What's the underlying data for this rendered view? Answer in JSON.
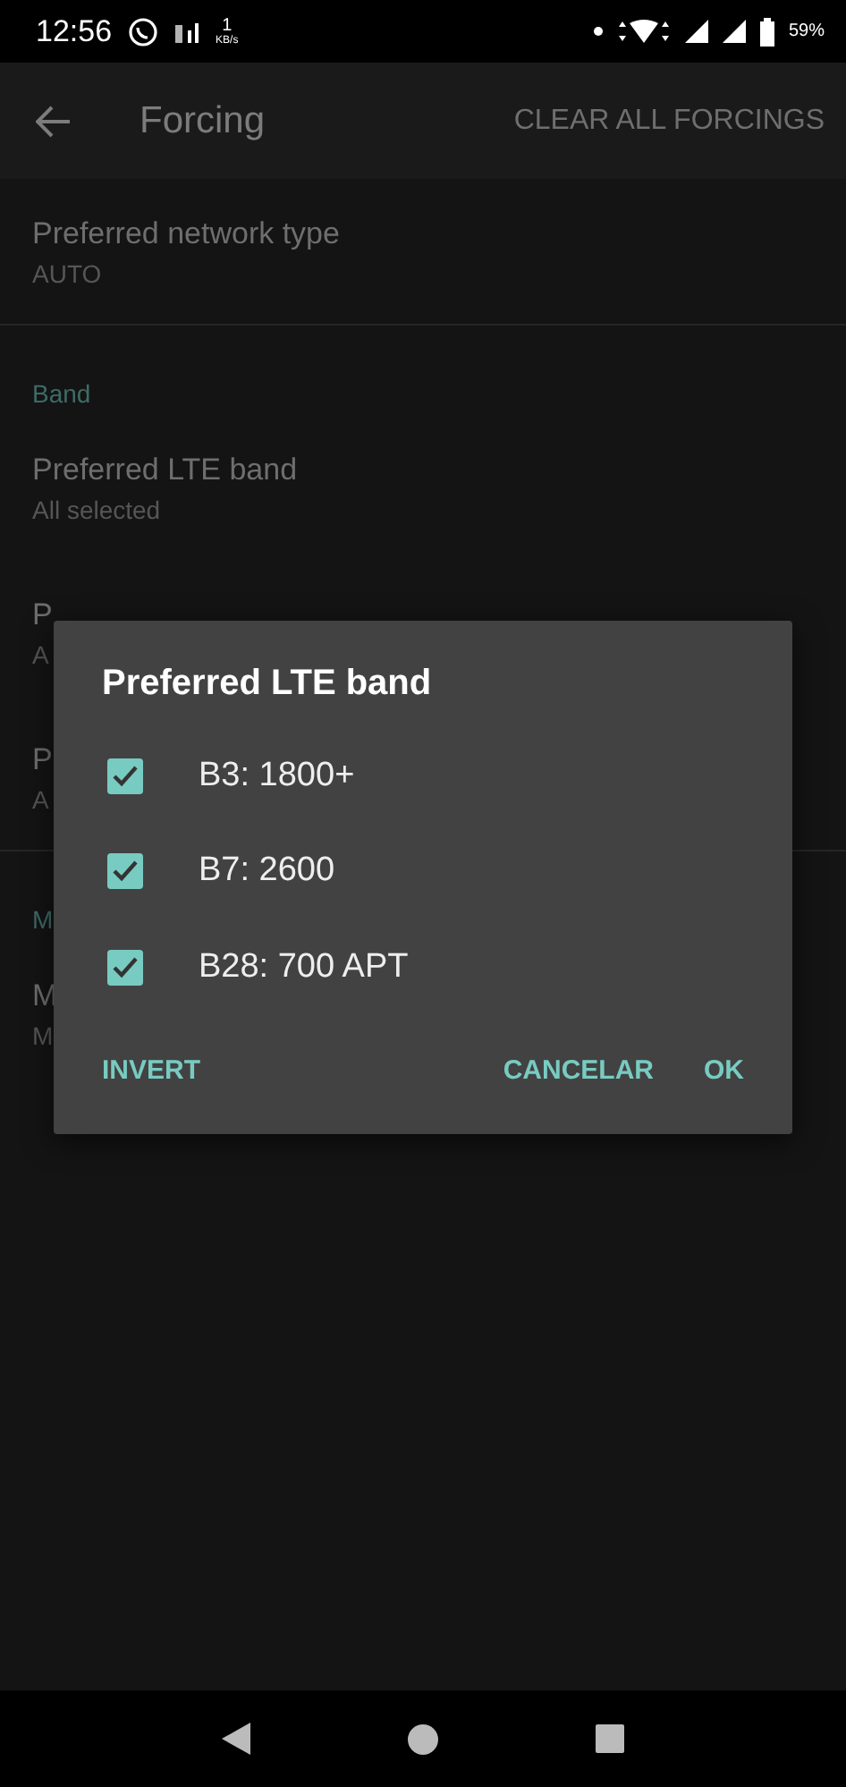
{
  "status_bar": {
    "time": "12:56",
    "speed_value": "1",
    "speed_unit": "KB/s",
    "battery": "59%"
  },
  "toolbar": {
    "title": "Forcing",
    "action": "CLEAR ALL FORCINGS"
  },
  "list": [
    {
      "kind": "row",
      "title": "Preferred network type",
      "subtitle": "AUTO"
    },
    {
      "kind": "divider"
    },
    {
      "kind": "section",
      "title": "Band"
    },
    {
      "kind": "row",
      "title": "Preferred LTE band",
      "subtitle": "All selected"
    },
    {
      "kind": "row",
      "title": "P",
      "subtitle": "A"
    },
    {
      "kind": "row",
      "title": "P",
      "subtitle": "A"
    },
    {
      "kind": "divider"
    },
    {
      "kind": "section",
      "title": "M"
    },
    {
      "kind": "row",
      "title": "M",
      "subtitle": "M"
    }
  ],
  "dialog": {
    "title": "Preferred LTE band",
    "options": [
      {
        "label": "B3: 1800+",
        "checked": true
      },
      {
        "label": "B7: 2600",
        "checked": true
      },
      {
        "label": "B28: 700 APT",
        "checked": true
      }
    ],
    "buttons": [
      "INVERT",
      "CANCELAR",
      "OK"
    ]
  }
}
